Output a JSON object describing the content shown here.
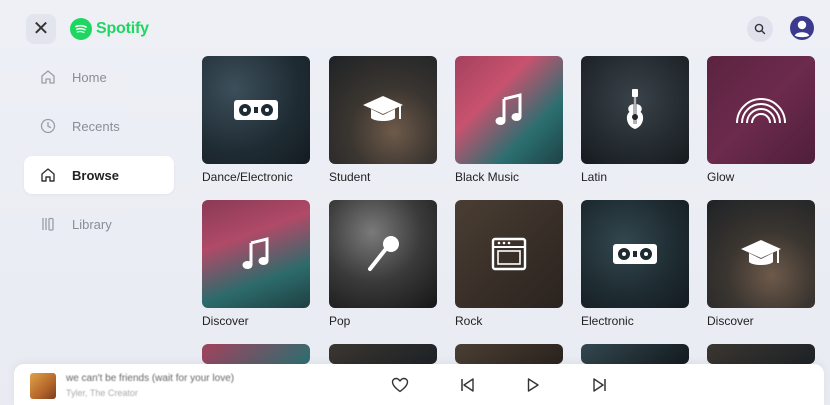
{
  "app": {
    "name": "Spotify",
    "brand_color": "#1ed760"
  },
  "topbar": {
    "close_icon": "close-icon",
    "search_icon": "search-icon",
    "profile_icon": "account-icon"
  },
  "sidebar": {
    "items": [
      {
        "label": "Home",
        "icon": "home-icon",
        "active": false
      },
      {
        "label": "Recents",
        "icon": "clock-icon",
        "active": false
      },
      {
        "label": "Browse",
        "icon": "browse-icon",
        "active": true
      },
      {
        "label": "Library",
        "icon": "library-icon",
        "active": false
      }
    ]
  },
  "categories": [
    {
      "label": "Dance/Electronic",
      "icon": "turntable-icon"
    },
    {
      "label": "Student",
      "icon": "graduation-cap-icon"
    },
    {
      "label": "Black Music",
      "icon": "music-note-icon"
    },
    {
      "label": "Latin",
      "icon": "guitar-icon"
    },
    {
      "label": "Glow",
      "icon": "rainbow-icon"
    },
    {
      "label": "Discover",
      "icon": "music-note-icon"
    },
    {
      "label": "Pop",
      "icon": "microphone-icon"
    },
    {
      "label": "Rock",
      "icon": "amplifier-icon"
    },
    {
      "label": "Electronic",
      "icon": "turntable-icon"
    },
    {
      "label": "Discover",
      "icon": "graduation-cap-icon"
    }
  ],
  "player": {
    "track_title": "we can't be friends (wait for your love)",
    "track_artist": "Tyler, The Creator",
    "controls": [
      "heart-icon",
      "previous-icon",
      "play-icon",
      "next-icon"
    ]
  }
}
